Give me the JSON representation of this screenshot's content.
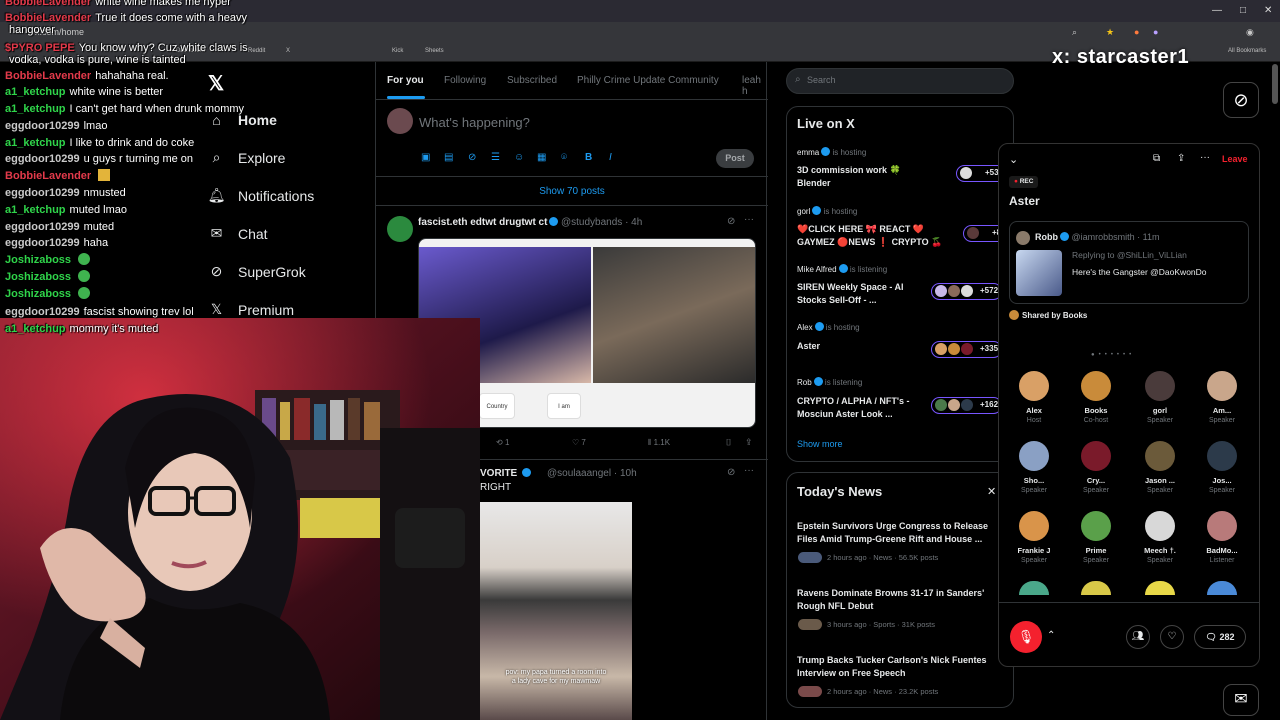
{
  "browser": {
    "url": "x.com/home",
    "bookmarks": [
      "Dashboard",
      "Reddit",
      "X",
      "Kick",
      "Sheets",
      "All Bookmarks"
    ],
    "all_bookmarks": "All Bookmarks"
  },
  "overlay": {
    "handle": "x: starcaster1"
  },
  "chat": [
    {
      "user": "BobbieLavender",
      "color": "#e33a4b",
      "msg": "white wine makes me hyper"
    },
    {
      "user": "BobbieLavender",
      "color": "#e33a4b",
      "msg": "True it does come with a heavy"
    },
    {
      "user": "",
      "color": "#fff",
      "msg": "hangover"
    },
    {
      "user": "$PYRO PEPE",
      "color": "#e33a4b",
      "msg": "You know why? Cuz white claws is"
    },
    {
      "user": "",
      "color": "#fff",
      "msg": "vodka, vodka is pure, wine is tainted"
    },
    {
      "user": "BobbieLavender",
      "color": "#e33a4b",
      "msg": "hahahaha real."
    },
    {
      "user": "a1_ketchup",
      "color": "#2fd44a",
      "msg": "white wine is better"
    },
    {
      "user": "a1_ketchup",
      "color": "#2fd44a",
      "msg": "I can't get hard when drunk mommy"
    },
    {
      "user": "eggdoor10299",
      "color": "#c9c9c9",
      "msg": "lmao"
    },
    {
      "user": "a1_ketchup",
      "color": "#2fd44a",
      "msg": "I like to drink and do coke"
    },
    {
      "user": "eggdoor10299",
      "color": "#c9c9c9",
      "msg": "u guys r turning me on"
    },
    {
      "user": "BobbieLavender",
      "color": "#e33a4b",
      "msg": ""
    },
    {
      "user": "eggdoor10299",
      "color": "#c9c9c9",
      "msg": "nmusted"
    },
    {
      "user": "a1_ketchup",
      "color": "#2fd44a",
      "msg": "muted lmao"
    },
    {
      "user": "eggdoor10299",
      "color": "#c9c9c9",
      "msg": "muted"
    },
    {
      "user": "eggdoor10299",
      "color": "#c9c9c9",
      "msg": "haha"
    },
    {
      "user": "Joshizaboss",
      "color": "#2fd44a",
      "msg": ""
    },
    {
      "user": "Joshizaboss",
      "color": "#2fd44a",
      "msg": ""
    },
    {
      "user": "Joshizaboss",
      "color": "#2fd44a",
      "msg": ""
    },
    {
      "user": "eggdoor10299",
      "color": "#c9c9c9",
      "msg": "fascist showing trev lol"
    },
    {
      "user": "a1_ketchup",
      "color": "#2fd44a",
      "msg": "mommy it's muted"
    }
  ],
  "nav": {
    "items": [
      "Home",
      "Explore",
      "Notifications",
      "Chat",
      "SuperGrok",
      "Premium"
    ]
  },
  "tabs": [
    "For you",
    "Following",
    "Subscribed",
    "Philly Crime Update Community",
    "leah h"
  ],
  "composer": {
    "placeholder": "What's happening?",
    "post": "Post"
  },
  "show_posts": "Show 70 posts",
  "tweet1": {
    "name": "fascist.eth edtwt drugtwt ct",
    "handle": "@studybands · 4h",
    "img_left_country": "Country",
    "img_left_iam": "I am",
    "retweets": "1",
    "likes": "7",
    "views": "1.1K"
  },
  "tweet2": {
    "name": "VORITE ",
    "line2": "RIGHT",
    "handle": "@soulaaangel · 10h",
    "caption": "pov: my papa turned a room into a lady cave for my mawmaw"
  },
  "search": {
    "placeholder": "Search"
  },
  "live": {
    "title": "Live on X",
    "items": [
      {
        "host": "emma",
        "status": "is hosting",
        "title": "3D commission work 🍀",
        "title2": "Blender",
        "count": "+531"
      },
      {
        "host": "gorl",
        "status": "is hosting",
        "title": "❤️CLICK HERE 🎀 REACT ❤️",
        "title2": "GAYMEZ 🔴NEWS ❗ CRYPTO 🍒",
        "count": "+89"
      },
      {
        "host": "Mike Alfred",
        "status": "is listening",
        "title": "SIREN Weekly Space - AI",
        "title2": "Stocks Sell-Off - ...",
        "count": "+572"
      },
      {
        "host": "Alex",
        "status": "is hosting",
        "title": "Aster",
        "title2": "",
        "count": "+335"
      },
      {
        "host": "Rob",
        "status": "is listening",
        "title": "CRYPTO / ALPHA / NFT's -",
        "title2": "Mosciun Aster Look ...",
        "count": "+162"
      }
    ],
    "show_more": "Show more"
  },
  "news": {
    "title": "Today's News",
    "items": [
      {
        "t1": "Epstein Survivors Urge Congress to Release",
        "t2": "Files Amid Trump-Greene Rift and House ...",
        "meta": "2 hours ago · News · 56.5K posts"
      },
      {
        "t1": "Ravens Dominate Browns 31-17 in Sanders'",
        "t2": "Rough NFL Debut",
        "meta": "3 hours ago · Sports · 31K posts"
      },
      {
        "t1": "Trump Backs Tucker Carlson's Nick Fuentes",
        "t2": "Interview on Free Speech",
        "meta": "2 hours ago · News · 23.2K posts"
      }
    ]
  },
  "space": {
    "rec": "REC",
    "title": "Aster",
    "leave": "Leave",
    "pinned": {
      "name": "Robb",
      "handle": "@iamrobbsmith · 11m",
      "reply": "Replying to @ShiLLin_ViLLian",
      "text": "Here's the Gangster @DaoKwonDo"
    },
    "shared": "Shared by Books",
    "speakers": [
      {
        "name": "Alex",
        "role": "Host",
        "color": "#d9a066"
      },
      {
        "name": "Books",
        "role": "Co-host",
        "color": "#c98b3a"
      },
      {
        "name": "gorl",
        "role": "Speaker",
        "color": "#4a3b3b"
      },
      {
        "name": "Am...",
        "role": "Speaker",
        "color": "#c9a68b"
      },
      {
        "name": "Sho...",
        "role": "Speaker",
        "color": "#8aa0c4"
      },
      {
        "name": "Cry...",
        "role": "Speaker",
        "color": "#7a1a2a"
      },
      {
        "name": "Jason ...",
        "role": "Speaker",
        "color": "#6b5a3a"
      },
      {
        "name": "Jos...",
        "role": "Speaker",
        "color": "#2c3a4a"
      },
      {
        "name": "Frankie J",
        "role": "Speaker",
        "color": "#d9944a"
      },
      {
        "name": "Prime",
        "role": "Speaker",
        "color": "#5aa04a"
      },
      {
        "name": "Meech †.",
        "role": "Speaker",
        "color": "#d8d8d8"
      },
      {
        "name": "BadMo...",
        "role": "Listener",
        "color": "#b87a7a"
      }
    ],
    "comments": "282"
  }
}
